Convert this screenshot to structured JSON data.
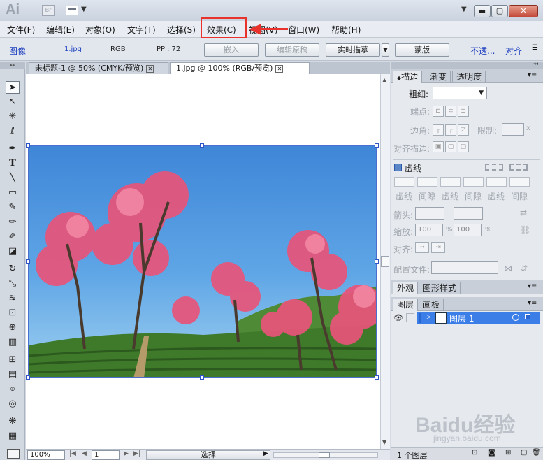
{
  "titlebar": {
    "app_logo": "Ai",
    "bridge_label": "Br",
    "window_buttons": {
      "minimize": "▬",
      "maximize": "▢",
      "close": "✕"
    }
  },
  "menubar": {
    "items": [
      "文件(F)",
      "编辑(E)",
      "对象(O)",
      "文字(T)",
      "选择(S)",
      "效果(C)",
      "视图(V)",
      "窗口(W)",
      "帮助(H)"
    ],
    "highlighted": "效果(C)",
    "highlight_color": "#e8322b"
  },
  "controlbar": {
    "type_label": "图像",
    "file_link": "1.jpg",
    "color_mode": "RGB",
    "ppi": "PPI: 72",
    "embed_button": "嵌入",
    "edit_original_button": "编辑原稿",
    "live_trace_button": "实时描摹",
    "mask_button": "蒙版",
    "opacity_link": "不透...",
    "align_link": "对齐"
  },
  "document": {
    "tabs": [
      {
        "label": "未标题-1 @ 50% (CMYK/预览)",
        "active": false
      },
      {
        "label": "1.jpg @ 100% (RGB/预览)",
        "active": true
      }
    ]
  },
  "statusbar": {
    "zoom": "100%",
    "page": "1",
    "selection_tool": "选择"
  },
  "panels": {
    "stroke_group_tabs": [
      "描边",
      "渐变",
      "透明度"
    ],
    "stroke": {
      "weight_label": "粗细:",
      "cap_label": "端点:",
      "corner_label": "边角:",
      "limit_label": "限制:",
      "limit_unit": "x",
      "align_label": "对齐描边:",
      "dashed_label": "虚线",
      "dash_labels": [
        "虚线",
        "间隙",
        "虚线",
        "间隙",
        "虚线",
        "间隙"
      ],
      "arrow_label": "箭头:",
      "scale_label": "缩放:",
      "scale_values": [
        "100",
        "100"
      ],
      "scale_unit": "%",
      "align_arrows_label": "对齐:",
      "profile_label": "配置文件:"
    },
    "appearance_tabs": [
      "外观",
      "图形样式"
    ],
    "layers_tabs": [
      "图层",
      "画板"
    ],
    "layers": {
      "layer_name": "图层 1",
      "footer_count": "1 个图层"
    }
  },
  "watermark": {
    "brand": "Baidu经验",
    "url": "jingyan.baidu.com"
  },
  "colors": {
    "accent_red": "#e8322b",
    "selection_blue": "#3c7ee8",
    "link_blue": "#1d3fbf"
  }
}
